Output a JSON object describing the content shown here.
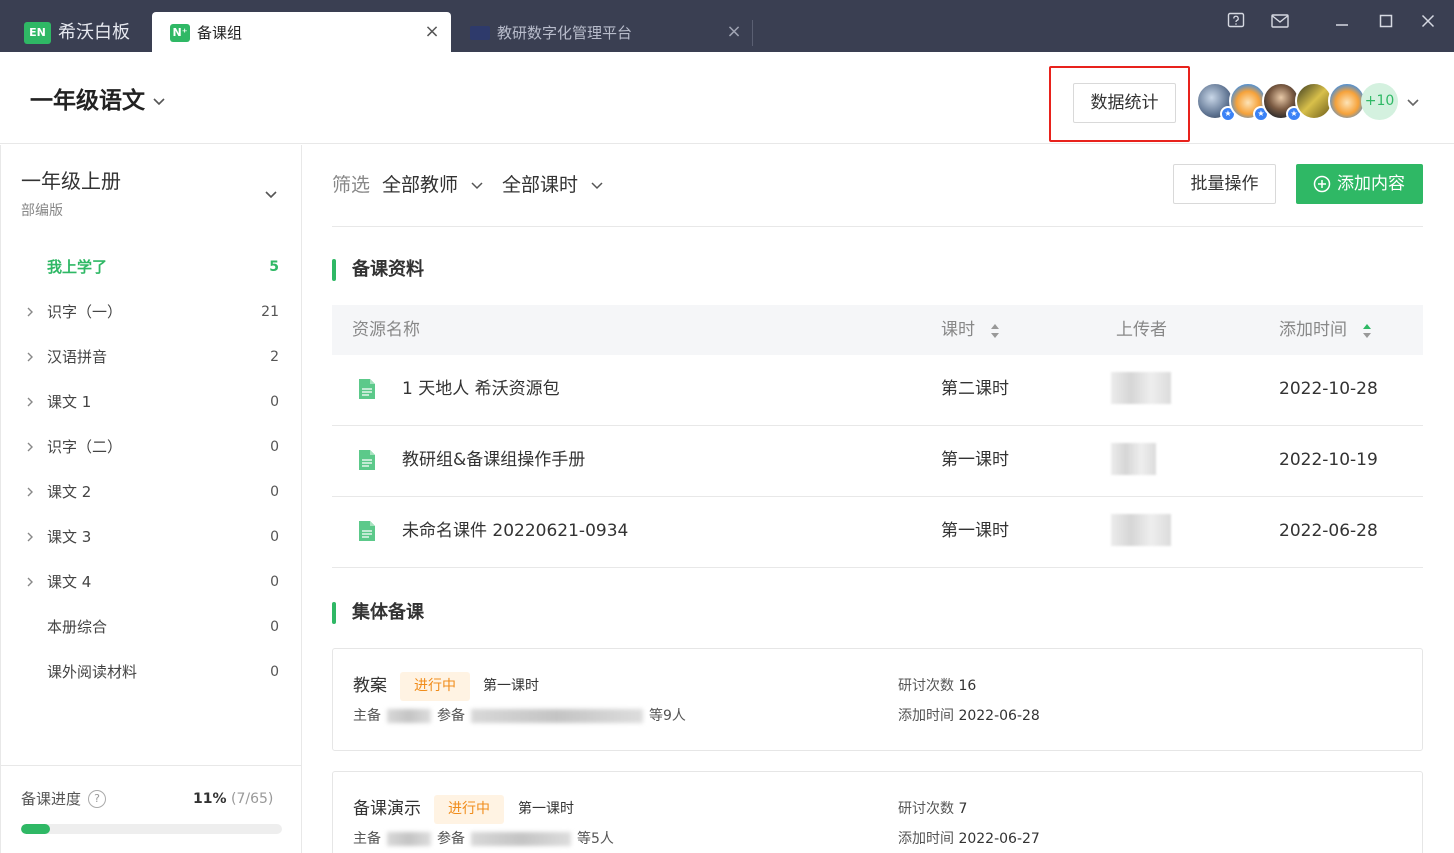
{
  "app": {
    "logo": "EN",
    "title": "希沃白板"
  },
  "tabs": [
    {
      "icon": "N⁺",
      "label": "备课组",
      "active": true
    },
    {
      "label": "教研数字化管理平台",
      "active": false
    }
  ],
  "header": {
    "course_title": "一年级语文",
    "stats_button": "数据统计",
    "more_members": "+10",
    "accent": "#2fb865",
    "highlight_color": "#e8221c"
  },
  "sidebar": {
    "volume_title": "一年级上册",
    "volume_sub": "部编版",
    "items": [
      {
        "label": "我上学了",
        "count": "5",
        "active": true,
        "expandable": false
      },
      {
        "label": "识字（一）",
        "count": "21",
        "expandable": true
      },
      {
        "label": "汉语拼音",
        "count": "2",
        "expandable": true
      },
      {
        "label": "课文 1",
        "count": "0",
        "expandable": true
      },
      {
        "label": "识字（二）",
        "count": "0",
        "expandable": true
      },
      {
        "label": "课文 2",
        "count": "0",
        "expandable": true
      },
      {
        "label": "课文 3",
        "count": "0",
        "expandable": true
      },
      {
        "label": "课文 4",
        "count": "0",
        "expandable": true
      },
      {
        "label": "本册综合",
        "count": "0",
        "expandable": false
      },
      {
        "label": "课外阅读材料",
        "count": "0",
        "expandable": false
      }
    ],
    "progress": {
      "label": "备课进度",
      "percent_text": "11%",
      "fraction": "(7/65)",
      "value": 0.11
    }
  },
  "filters": {
    "label": "筛选",
    "teacher": "全部教师",
    "lesson": "全部课时",
    "batch_button": "批量操作",
    "add_button": "添加内容"
  },
  "materials": {
    "section_title": "备课资料",
    "columns": [
      "资源名称",
      "课时",
      "上传者",
      "添加时间"
    ],
    "rows": [
      {
        "name": "1 天地人 希沃资源包",
        "lesson": "第二课时",
        "date": "2022-10-28"
      },
      {
        "name": "教研组&备课组操作手册",
        "lesson": "第一课时",
        "date": "2022-10-19"
      },
      {
        "name": "未命名课件 20220621-0934",
        "lesson": "第一课时",
        "date": "2022-06-28"
      }
    ]
  },
  "collective": {
    "section_title": "集体备课",
    "cards": [
      {
        "title": "教案",
        "status": "进行中",
        "lesson": "第一课时",
        "host_label": "主备",
        "participants_label": "参备",
        "participants_suffix": "等9人",
        "discuss_label": "研讨次数",
        "discuss_count": "16",
        "added_label": "添加时间",
        "added_date": "2022-06-28"
      },
      {
        "title": "备课演示",
        "status": "进行中",
        "lesson": "第一课时",
        "host_label": "主备",
        "participants_label": "参备",
        "participants_suffix": "等5人",
        "discuss_label": "研讨次数",
        "discuss_count": "7",
        "added_label": "添加时间",
        "added_date": "2022-06-27"
      }
    ]
  }
}
